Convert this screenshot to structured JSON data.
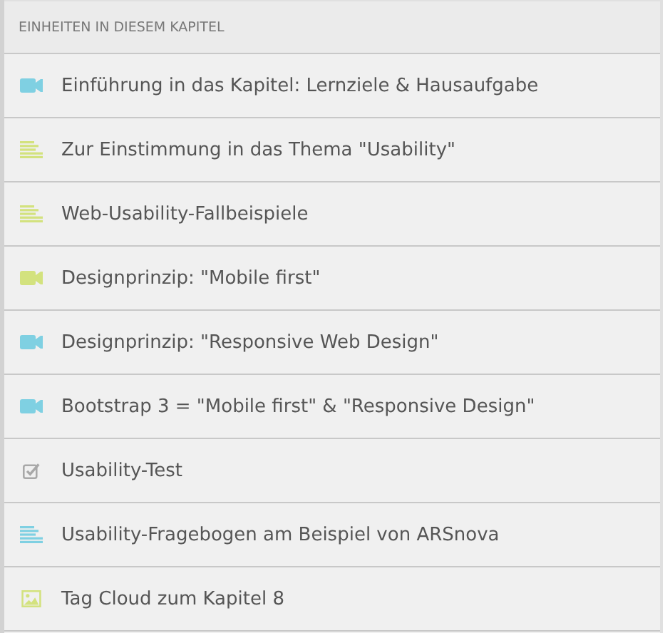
{
  "header": "EINHEITEN IN DIESEM KAPITEL",
  "units": [
    {
      "kind": "video",
      "color": "#7fd0e2",
      "title": "Einführung in das Kapitel: Lernziele & Hausaufgabe"
    },
    {
      "kind": "text",
      "color": "#d3e27e",
      "title": "Zur Einstimmung in das Thema \"Usability\""
    },
    {
      "kind": "text",
      "color": "#d3e27e",
      "title": "Web-Usability-Fallbeispiele"
    },
    {
      "kind": "video",
      "color": "#d3e27e",
      "title": "Designprinzip: \"Mobile first\""
    },
    {
      "kind": "video",
      "color": "#7fd0e2",
      "title": "Designprinzip: \"Responsive Web Design\""
    },
    {
      "kind": "video",
      "color": "#7fd0e2",
      "title": "Bootstrap 3 = \"Mobile first\" & \"Responsive Design\""
    },
    {
      "kind": "test",
      "color": "#a8a8a8",
      "title": "Usability-Test"
    },
    {
      "kind": "text",
      "color": "#7fd0e2",
      "title": "Usability-Fragebogen am Beispiel von ARSnova"
    },
    {
      "kind": "image",
      "color": "#d3e27e",
      "title": "Tag Cloud zum Kapitel 8"
    }
  ]
}
